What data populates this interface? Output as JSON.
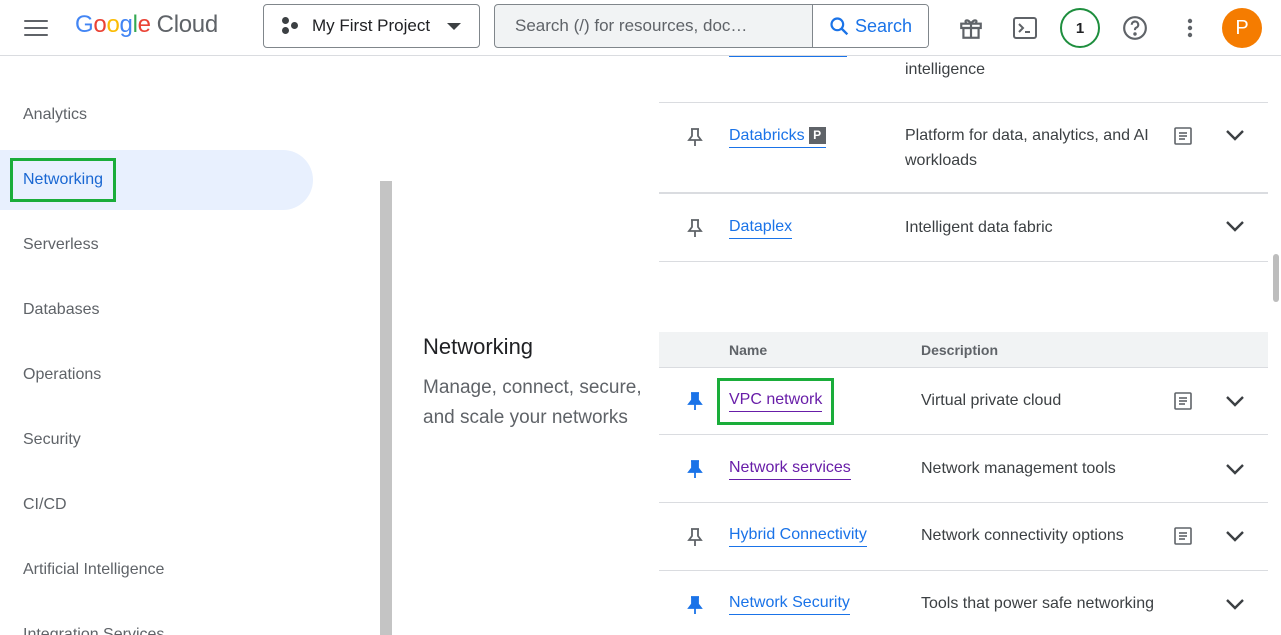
{
  "header": {
    "logo": {
      "G": "G",
      "o1": "o",
      "o2": "o",
      "g": "g",
      "l": "l",
      "e": "e",
      "cloud": "Cloud"
    },
    "project_label": "My First Project",
    "search_placeholder": "Search (/) for resources, doc…",
    "search_button": "Search",
    "notifications_count": "1",
    "avatar_letter": "P"
  },
  "sidebar": {
    "items": [
      {
        "label": "Analytics",
        "active": false
      },
      {
        "label": "Networking",
        "active": true
      },
      {
        "label": "Serverless",
        "active": false
      },
      {
        "label": "Databases",
        "active": false
      },
      {
        "label": "Operations",
        "active": false
      },
      {
        "label": "Security",
        "active": false
      },
      {
        "label": "CI/CD",
        "active": false
      },
      {
        "label": "Artificial Intelligence",
        "active": false
      },
      {
        "label": "Integration Services",
        "active": false
      }
    ]
  },
  "prev_section": {
    "rows": [
      {
        "name": "",
        "desc": "intelligence"
      },
      {
        "name": "Databricks",
        "badge": "P",
        "desc": "Platform for data, analytics, and AI workloads"
      },
      {
        "name": "Dataplex",
        "desc": "Intelligent data fabric"
      }
    ]
  },
  "networking": {
    "title": "Networking",
    "description": "Manage, connect, secure, and scale your networks",
    "col_name": "Name",
    "col_desc": "Description",
    "rows": [
      {
        "name": "VPC network",
        "desc": "Virtual private cloud",
        "pinned": true,
        "docs": true
      },
      {
        "name": "Network services",
        "desc": "Network management tools",
        "pinned": true,
        "docs": false
      },
      {
        "name": "Hybrid Connectivity",
        "desc": "Network connectivity options",
        "pinned": false,
        "docs": true
      },
      {
        "name": "Network Security",
        "desc": "Tools that power safe networking",
        "pinned": true,
        "docs": false
      }
    ]
  },
  "colors": {
    "link": "#1a73e8",
    "visited": "#681da8",
    "highlight": "#1aad3a",
    "active_bg": "#e8f0fe"
  }
}
